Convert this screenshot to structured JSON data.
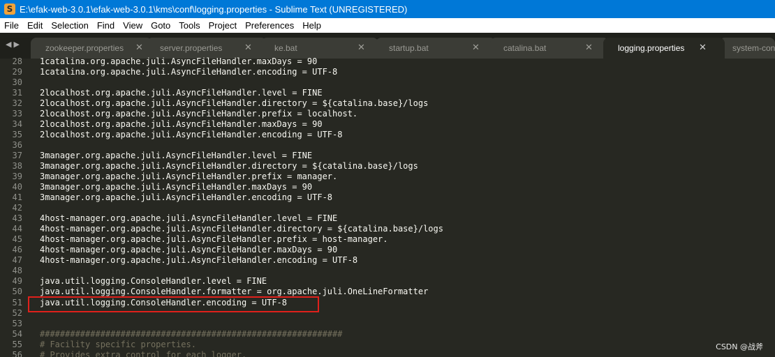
{
  "window": {
    "title": "E:\\efak-web-3.0.1\\efak-web-3.0.1\\kms\\conf\\logging.properties - Sublime Text (UNREGISTERED)",
    "icon_glyph": "S"
  },
  "menu": [
    "File",
    "Edit",
    "Selection",
    "Find",
    "View",
    "Goto",
    "Tools",
    "Project",
    "Preferences",
    "Help"
  ],
  "nav_arrows": "◀▶",
  "tabs": [
    {
      "label": "zookeeper.properties",
      "close": "✕",
      "active": false
    },
    {
      "label": "server.properties",
      "close": "✕",
      "active": false
    },
    {
      "label": "ke.bat",
      "close": "✕",
      "active": false
    },
    {
      "label": "startup.bat",
      "close": "✕",
      "active": false
    },
    {
      "label": "catalina.bat",
      "close": "✕",
      "active": false
    },
    {
      "label": "logging.properties",
      "close": "✕",
      "active": true
    },
    {
      "label": "system-config",
      "close": "",
      "active": false
    }
  ],
  "editor": {
    "lines": [
      {
        "n": "28",
        "text": "1catalina.org.apache.juli.AsyncFileHandler.maxDays = 90"
      },
      {
        "n": "29",
        "text": "1catalina.org.apache.juli.AsyncFileHandler.encoding = UTF-8"
      },
      {
        "n": "30",
        "text": ""
      },
      {
        "n": "31",
        "text": "2localhost.org.apache.juli.AsyncFileHandler.level = FINE"
      },
      {
        "n": "32",
        "text": "2localhost.org.apache.juli.AsyncFileHandler.directory = ${catalina.base}/logs"
      },
      {
        "n": "33",
        "text": "2localhost.org.apache.juli.AsyncFileHandler.prefix = localhost."
      },
      {
        "n": "34",
        "text": "2localhost.org.apache.juli.AsyncFileHandler.maxDays = 90"
      },
      {
        "n": "35",
        "text": "2localhost.org.apache.juli.AsyncFileHandler.encoding = UTF-8"
      },
      {
        "n": "36",
        "text": ""
      },
      {
        "n": "37",
        "text": "3manager.org.apache.juli.AsyncFileHandler.level = FINE"
      },
      {
        "n": "38",
        "text": "3manager.org.apache.juli.AsyncFileHandler.directory = ${catalina.base}/logs"
      },
      {
        "n": "39",
        "text": "3manager.org.apache.juli.AsyncFileHandler.prefix = manager."
      },
      {
        "n": "40",
        "text": "3manager.org.apache.juli.AsyncFileHandler.maxDays = 90"
      },
      {
        "n": "41",
        "text": "3manager.org.apache.juli.AsyncFileHandler.encoding = UTF-8"
      },
      {
        "n": "42",
        "text": ""
      },
      {
        "n": "43",
        "text": "4host-manager.org.apache.juli.AsyncFileHandler.level = FINE"
      },
      {
        "n": "44",
        "text": "4host-manager.org.apache.juli.AsyncFileHandler.directory = ${catalina.base}/logs"
      },
      {
        "n": "45",
        "text": "4host-manager.org.apache.juli.AsyncFileHandler.prefix = host-manager."
      },
      {
        "n": "46",
        "text": "4host-manager.org.apache.juli.AsyncFileHandler.maxDays = 90"
      },
      {
        "n": "47",
        "text": "4host-manager.org.apache.juli.AsyncFileHandler.encoding = UTF-8"
      },
      {
        "n": "48",
        "text": ""
      },
      {
        "n": "49",
        "text": "java.util.logging.ConsoleHandler.level = FINE"
      },
      {
        "n": "50",
        "text": "java.util.logging.ConsoleHandler.formatter = org.apache.juli.OneLineFormatter"
      },
      {
        "n": "51",
        "text": "java.util.logging.ConsoleHandler.encoding = UTF-8"
      },
      {
        "n": "52",
        "text": ""
      },
      {
        "n": "53",
        "text": ""
      },
      {
        "n": "54",
        "text": "############################################################",
        "comment": true
      },
      {
        "n": "55",
        "text": "# Facility specific properties.",
        "comment": true
      },
      {
        "n": "56",
        "text": "# Provides extra control for each logger.",
        "comment": true
      }
    ]
  },
  "watermark": "CSDN @战斧",
  "colors": {
    "titlebar": "#0078d7",
    "editor_bg": "#272822",
    "tab_bg": "#3b3c36",
    "highlight_border": "#e0201b"
  }
}
